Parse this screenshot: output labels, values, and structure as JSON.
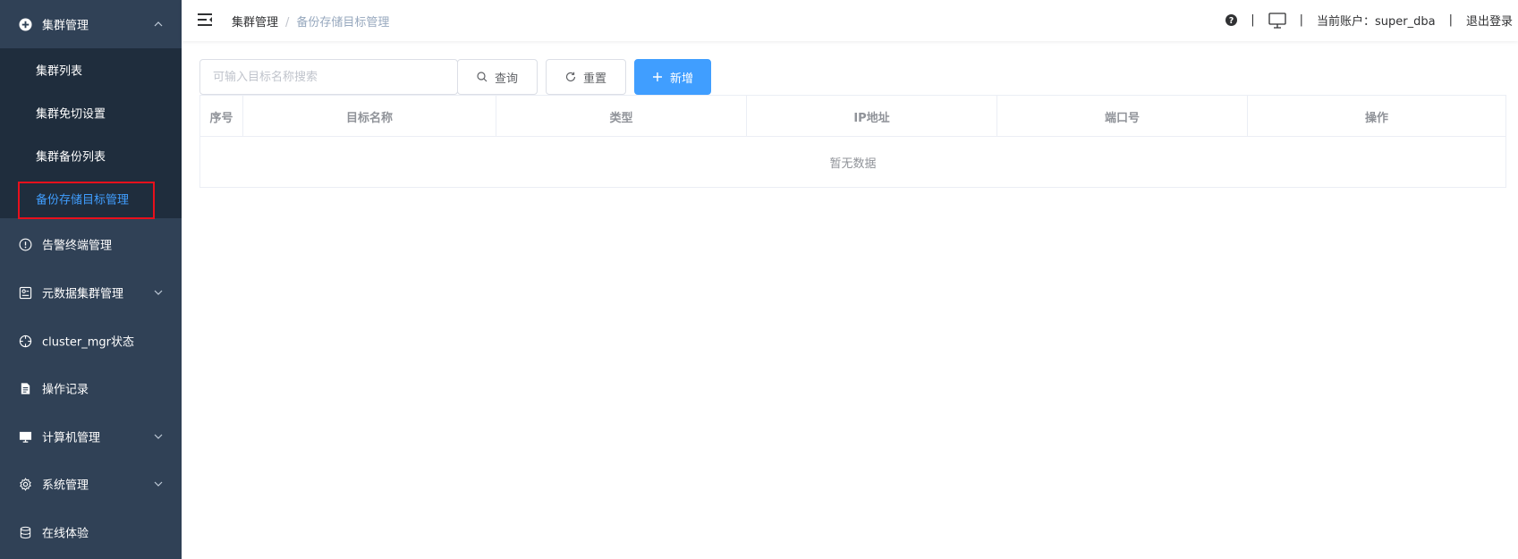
{
  "sidebar": {
    "cluster_mgmt": {
      "label": "集群管理",
      "icon": "cluster-icon"
    },
    "sub_items": [
      {
        "label": "集群列表"
      },
      {
        "label": "集群免切设置"
      },
      {
        "label": "集群备份列表"
      },
      {
        "label": "备份存储目标管理"
      }
    ],
    "items": [
      {
        "label": "告警终端管理",
        "icon": "alert-icon"
      },
      {
        "label": "元数据集群管理",
        "icon": "metadata-icon"
      },
      {
        "label": "cluster_mgr状态",
        "icon": "crosshair-icon"
      },
      {
        "label": "操作记录",
        "icon": "document-icon"
      },
      {
        "label": "计算机管理",
        "icon": "monitor-icon"
      },
      {
        "label": "系统管理",
        "icon": "gear-icon"
      },
      {
        "label": "在线体验",
        "icon": "database-icon"
      }
    ],
    "colors": {
      "background": "#304156",
      "submenu_background": "#1f2d3d",
      "active": "#409eff",
      "highlight_border": "#e8101c"
    }
  },
  "header": {
    "breadcrumb": [
      "集群管理",
      "备份存储目标管理"
    ],
    "breadcrumb_separator": "/",
    "separator": "|",
    "account": "当前账户：super_dba",
    "logout": "退出登录"
  },
  "toolbar": {
    "search_placeholder": "可输入目标名称搜索",
    "query_label": "查询",
    "reset_label": "重置",
    "add_label": "新增",
    "accent": "#409eff"
  },
  "table": {
    "columns": [
      "序号",
      "目标名称",
      "类型",
      "IP地址",
      "端口号",
      "操作"
    ],
    "empty_text": "暂无数据"
  }
}
